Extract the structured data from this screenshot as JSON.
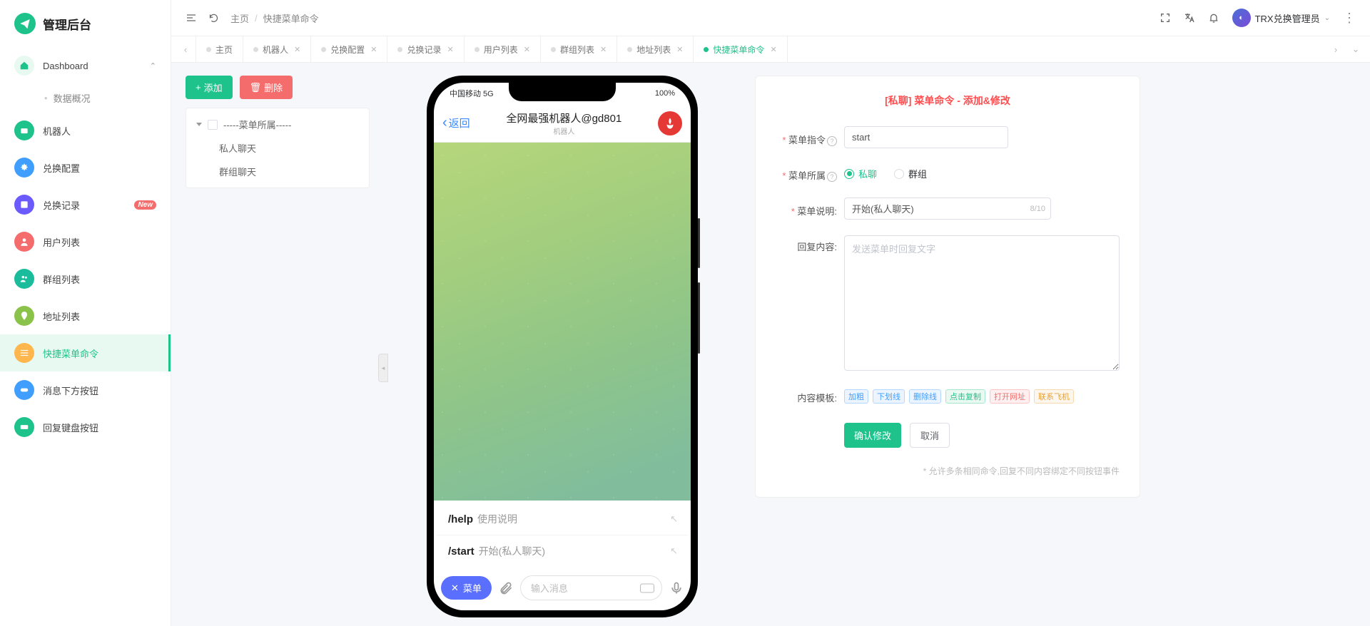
{
  "brand": {
    "name": "管理后台"
  },
  "breadcrumb": {
    "home": "主页",
    "current": "快捷菜单命令"
  },
  "user": {
    "name": "TRX兑换管理员"
  },
  "sidebar": {
    "items": [
      {
        "label": "Dashboard"
      },
      {
        "label": "数据概况"
      },
      {
        "label": "机器人"
      },
      {
        "label": "兑换配置"
      },
      {
        "label": "兑换记录",
        "badge": "New"
      },
      {
        "label": "用户列表"
      },
      {
        "label": "群组列表"
      },
      {
        "label": "地址列表"
      },
      {
        "label": "快捷菜单命令"
      },
      {
        "label": "消息下方按钮"
      },
      {
        "label": "回复键盘按钮"
      }
    ]
  },
  "tabs": [
    {
      "label": "主页"
    },
    {
      "label": "机器人"
    },
    {
      "label": "兑换配置"
    },
    {
      "label": "兑换记录"
    },
    {
      "label": "用户列表"
    },
    {
      "label": "群组列表"
    },
    {
      "label": "地址列表"
    },
    {
      "label": "快捷菜单命令"
    }
  ],
  "buttons": {
    "add": "添加",
    "delete": "删除",
    "confirm": "确认修改",
    "cancel": "取消"
  },
  "tree": {
    "root": "-----菜单所属-----",
    "children": [
      "私人聊天",
      "群组聊天"
    ]
  },
  "phone": {
    "carrier": "中国移动 5G",
    "battery": "100%",
    "back": "返回",
    "title": "全网最强机器人@gd801",
    "subtitle": "机器人",
    "commands": [
      {
        "key": "/help",
        "desc": "使用说明"
      },
      {
        "key": "/start",
        "desc": "开始(私人聊天)"
      }
    ],
    "menu_label": "菜单",
    "input_placeholder": "输入消息"
  },
  "form": {
    "title": "[私聊]  菜单命令 - 添加&修改",
    "labels": {
      "command": "菜单指令",
      "belong": "菜单所属",
      "desc": "菜单说明:",
      "reply": "回复内容:",
      "template": "内容模板:"
    },
    "command_value": "start",
    "belong_options": {
      "private": "私聊",
      "group": "群组"
    },
    "desc_value": "开始(私人聊天)",
    "desc_counter": "8/10",
    "reply_placeholder": "发送菜单时回复文字",
    "templates": [
      "加粗",
      "下划线",
      "删除线",
      "点击复制",
      "打开网址",
      "联系飞机"
    ],
    "note": "* 允许多条相同命令,回复不同内容绑定不同按钮事件"
  }
}
